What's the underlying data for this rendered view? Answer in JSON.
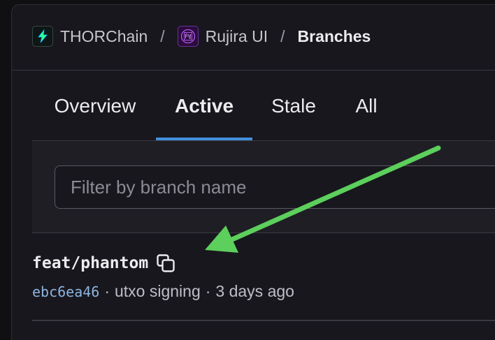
{
  "breadcrumb": {
    "items": [
      {
        "label": "THORChain",
        "icon": "thorchain-logo-icon"
      },
      {
        "label": "Rujira UI",
        "icon": "rujira-logo-icon"
      },
      {
        "label": "Branches"
      }
    ],
    "separator": "/"
  },
  "tabs": [
    {
      "label": "Overview",
      "active": false
    },
    {
      "label": "Active",
      "active": true
    },
    {
      "label": "Stale",
      "active": false
    },
    {
      "label": "All",
      "active": false
    }
  ],
  "filter": {
    "placeholder": "Filter by branch name",
    "value": ""
  },
  "branch": {
    "name": "feat/phantom",
    "copy_icon": "copy-icon",
    "commit_sha": "ebc6ea46",
    "commit_message": "utxo signing",
    "updated": "3 days ago",
    "separator": "·"
  },
  "annotation": {
    "arrow_color": "#5ccf5c",
    "arrow_icon": "annotation-arrow"
  },
  "colors": {
    "accent": "#428fdc",
    "background": "#18171d",
    "commit_link": "#8cb4e0"
  }
}
